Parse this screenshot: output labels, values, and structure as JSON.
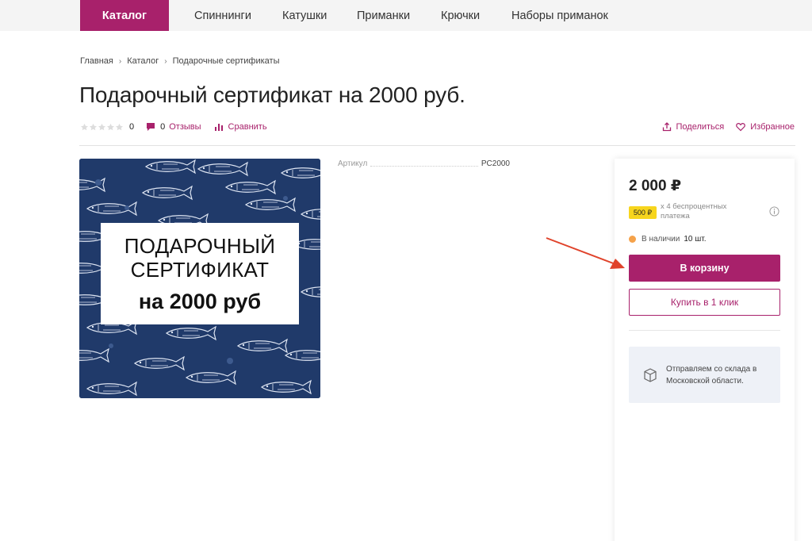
{
  "nav": {
    "items": [
      {
        "label": "Каталог",
        "active": true
      },
      {
        "label": "Спиннинги"
      },
      {
        "label": "Катушки"
      },
      {
        "label": "Приманки"
      },
      {
        "label": "Крючки"
      },
      {
        "label": "Наборы приманок"
      }
    ]
  },
  "breadcrumb": [
    "Главная",
    "Каталог",
    "Подарочные сертификаты"
  ],
  "product": {
    "title": "Подарочный сертификат на 2000 руб.",
    "rating_count": "0",
    "reviews_count": "0",
    "reviews_label": "Отзывы",
    "compare_label": "Сравнить",
    "share_label": "Поделиться",
    "favorite_label": "Избранное",
    "image": {
      "line1": "ПОДАРОЧНЫЙ",
      "line2": "СЕРТИФИКАТ",
      "line3": "на 2000 руб",
      "background": "#203a6a"
    },
    "article_label": "Артикул",
    "article_value": "PC2000"
  },
  "buy_panel": {
    "price": "2 000 ₽",
    "installment_badge": "500 ₽",
    "installment_text": "x 4 беспроцентных платежа",
    "stock_label": "В наличии",
    "stock_qty": "10 шт.",
    "cart_button": "В корзину",
    "oneclick_button": "Купить в 1 клик",
    "shipping_text": "Отправляем со склада в Московской области."
  },
  "colors": {
    "brand": "#a8216b",
    "installment_badge": "#f7d51d",
    "stock_dot": "#f5a24a",
    "annotation_arrow": "#e0432b"
  }
}
